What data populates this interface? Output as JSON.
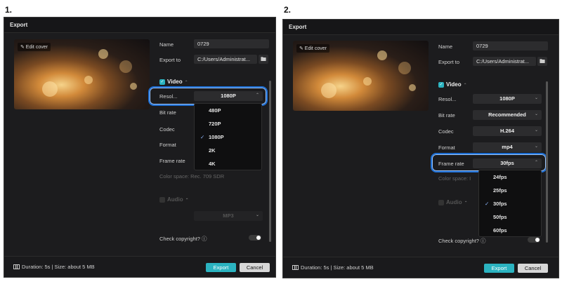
{
  "steps": [
    "1.",
    "2."
  ],
  "dialog": {
    "title": "Export",
    "edit_cover": "✎ Edit cover",
    "name_label": "Name",
    "name_value": "0729",
    "export_to_label": "Export to",
    "export_to_value": "C:/Users/Administrat...",
    "video_label": "Video",
    "resolution_label_short": "Resol...",
    "resolution_label": "Resolution",
    "resolution_value": "1080P",
    "bitrate_label": "Bit rate",
    "bitrate_value": "Recommended",
    "codec_label": "Codec",
    "codec_value": "H.264",
    "format_label": "Format",
    "format_value": "mp4",
    "framerate_label": "Frame rate",
    "framerate_value": "30fps",
    "color_space_1": "Color space: Rec. 709 SDR",
    "color_space_2": "Color space: I",
    "audio_label": "Audio",
    "audio_format": "MP3",
    "check_copyright": "Check copyright? ⓘ",
    "footer_info": "Duration: 5s | Size: about 5 MB",
    "export_button": "Export",
    "cancel_button": "Cancel"
  },
  "resolution_options": [
    "480P",
    "720P",
    "1080P",
    "2K",
    "4K"
  ],
  "resolution_selected": "1080P",
  "framerate_options": [
    "24fps",
    "25fps",
    "30fps",
    "50fps",
    "60fps"
  ],
  "framerate_selected": "30fps",
  "colors": {
    "accent": "#2bb3c0",
    "highlight": "#1e6fd4",
    "dialog_bg": "#1c1c1e"
  },
  "icons": {
    "folder": "folder-icon",
    "film": "film-icon",
    "check": "checkmark-icon",
    "chevron": "chevron-down-icon"
  }
}
